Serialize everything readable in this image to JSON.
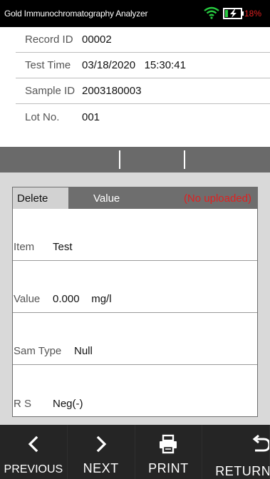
{
  "status_bar": {
    "title": "Gold Immunochromatography Analyzer",
    "battery_percent": "18%",
    "icons": [
      "wifi-icon",
      "battery-charging-icon"
    ],
    "battery_color": "#e02020"
  },
  "record": {
    "rows": [
      {
        "label": "Record ID",
        "value": "00002"
      },
      {
        "label": "Test Time",
        "value": "03/18/2020   15:30:41"
      },
      {
        "label": "Sample ID",
        "value": "2003180003"
      },
      {
        "label": "Lot No.",
        "value": "001"
      }
    ]
  },
  "result_panel": {
    "tabs": {
      "delete_label": "Delete",
      "value_label": "Value",
      "status_text": "(No uploaded)",
      "status_color": "#e02020"
    },
    "rows": [
      {
        "label": "Item",
        "value": "Test"
      },
      {
        "label": "Value",
        "value": "0.000    mg/l"
      },
      {
        "label": "Sam Type",
        "value": "Null"
      },
      {
        "label": "R S",
        "value": "Neg(-)"
      }
    ]
  },
  "bottom_nav": {
    "previous_label": "PREVIOUS",
    "next_label": "NEXT",
    "print_label": "PRINT",
    "return_label": "RETURN",
    "icons": [
      "chevron-left-icon",
      "chevron-right-icon",
      "printer-icon",
      "return-arrow-icon"
    ]
  }
}
